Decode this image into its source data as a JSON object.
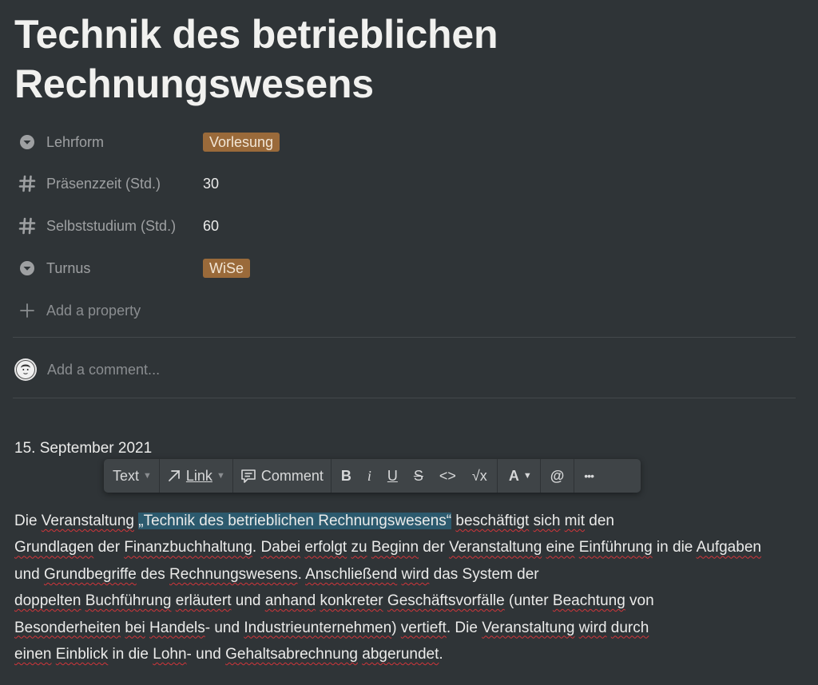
{
  "page": {
    "title_line1": "Technik des betrieblichen",
    "title_line2": "Rechnungswesens"
  },
  "properties": [
    {
      "icon": "select-icon",
      "label": "Lehrform",
      "value": "Vorlesung",
      "type": "tag",
      "tag_color": "#9a6a3a"
    },
    {
      "icon": "number-icon",
      "label": "Präsenzzeit (Std.)",
      "value": "30",
      "type": "number"
    },
    {
      "icon": "number-icon",
      "label": "Selbststudium (Std.)",
      "value": "60",
      "type": "number"
    },
    {
      "icon": "select-icon",
      "label": "Turnus",
      "value": "WiSe",
      "type": "tag",
      "tag_color": "#9a6a3a"
    }
  ],
  "add_property": "Add a property",
  "comment": {
    "placeholder": "Add a comment..."
  },
  "content": {
    "date": "15. September 2021",
    "paragraph": {
      "t01": "Die ",
      "t02": "Veranstaltung",
      "t03": " ",
      "t04": "„Technik des betrieblichen Rechnungswesens“",
      "t05": " ",
      "t06": "beschäftigt",
      "t07": " ",
      "t08": "sich",
      "t09": " ",
      "t10": "mit",
      "t11": " den ",
      "t12": "Grundlagen",
      "t13": " der ",
      "t14": "Finanzbuchhaltung",
      "t15": ". ",
      "t16": "Dabei",
      "t17": " ",
      "t18": "erfolgt",
      "t19": " ",
      "t20": "zu",
      "t21": " ",
      "t22": "Beginn",
      "t23": " der ",
      "t24": "Veranstaltung",
      "t25": " ",
      "t26": "eine",
      "t27": " ",
      "t28": "Einführung",
      "t29": " in die ",
      "t30": "Aufgaben",
      "t31": " und ",
      "t32": "Grundbegriffe",
      "t33": " des ",
      "t34": "Rechnungswesens",
      "t35": ". ",
      "t36": "Anschließend",
      "t37": " ",
      "t38": "wird",
      "t39": " das System der ",
      "t40": "doppelten",
      "t41": " ",
      "t42": "Buchführung",
      "t43": " ",
      "t44": "erläutert",
      "t45": " und ",
      "t46": "anhand",
      "t47": " ",
      "t48": "konkreter",
      "t49": " ",
      "t50": "Geschäftsvorfälle",
      "t51": " (unter ",
      "t52": "Beachtung",
      "t53": " von ",
      "t54": "Besonderheiten",
      "t55": " ",
      "t56": "bei",
      "t57": " ",
      "t58": "Handels",
      "t59": "- und ",
      "t60": "Industrieunternehmen",
      "t61": ") ",
      "t62": "vertieft",
      "t63": ". Die ",
      "t64": "Veranstaltung",
      "t65": " ",
      "t66": "wird",
      "t67": " ",
      "t68": "durch",
      "t69": " ",
      "t70": "einen",
      "t71": " ",
      "t72": "Einblick",
      "t73": " in die ",
      "t74": "Lohn",
      "t75": "- und ",
      "t76": "Gehaltsabrechnung",
      "t77": " ",
      "t78": "abgerundet",
      "t79": "."
    }
  },
  "toolbar": {
    "text_label": "Text",
    "link_label": "Link",
    "comment_label": "Comment",
    "bold": "B",
    "italic": "i",
    "underline": "U",
    "strike": "S",
    "code": "<>",
    "math": "√x",
    "color": "A",
    "mention": "@",
    "more": "•••"
  }
}
